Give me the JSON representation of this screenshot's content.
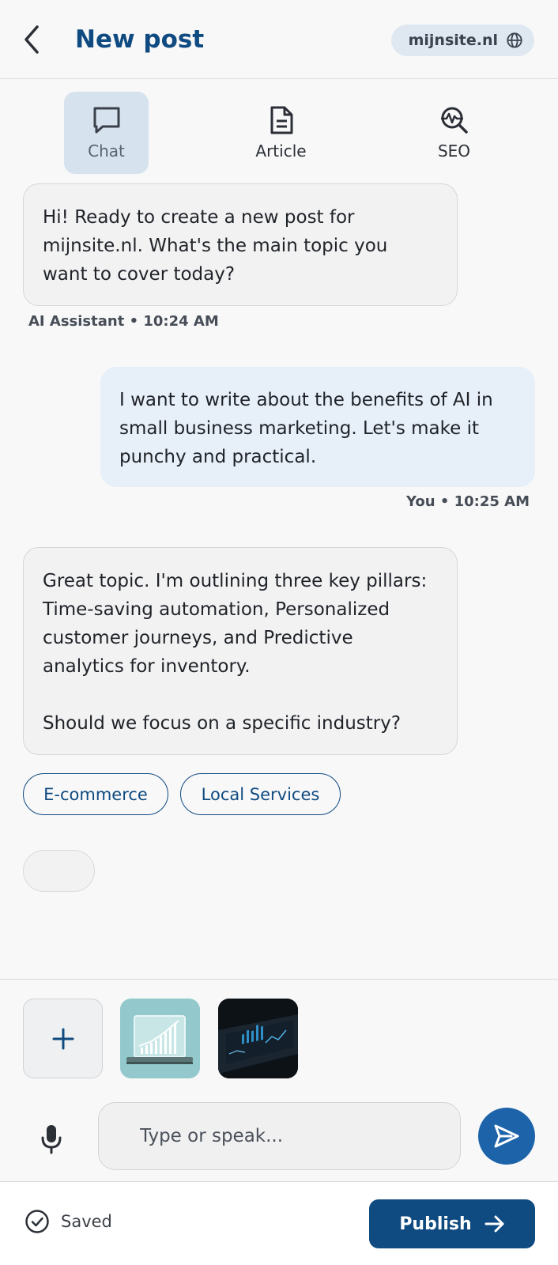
{
  "header": {
    "title": "New post",
    "site": "mijnsite.nl",
    "back_icon": "chevron-left-icon",
    "site_icon": "globe-icon"
  },
  "tabs": [
    {
      "label": "Chat",
      "icon": "chat-bubble-icon",
      "active": true
    },
    {
      "label": "Article",
      "icon": "document-icon",
      "active": false
    },
    {
      "label": "SEO",
      "icon": "seo-analytics-icon",
      "active": false
    }
  ],
  "messages": [
    {
      "from": "ai",
      "text": "Hi! Ready to create a new post for\nmijnsite.nl. What's the main topic you\nwant to cover today?",
      "meta": "AI Assistant • 10:24 AM"
    },
    {
      "from": "user",
      "text": "I want to write about the benefits of AI in\nsmall business marketing. Let's make it\npunchy and practical.",
      "meta": "You • 10:25 AM"
    },
    {
      "from": "ai",
      "text": "Great topic. I'm outlining three key pillars:\nTime-saving automation, Personalized\ncustomer journeys, and Predictive\nanalytics for inventory.\n\nShould we focus on a specific industry?"
    }
  ],
  "quick_replies": [
    "E-commerce",
    "Local Services"
  ],
  "composer": {
    "placeholder": "Type or speak...",
    "attachments": [
      "laptop-growth-chart-image",
      "dark-analytics-dashboard-image"
    ]
  },
  "footer": {
    "status": "Saved",
    "publish_label": "Publish"
  },
  "colors": {
    "brand": "#0f4a80",
    "send": "#1d63aa",
    "user_bubble": "#e7eff9",
    "ai_bubble": "#f2f2f3"
  }
}
